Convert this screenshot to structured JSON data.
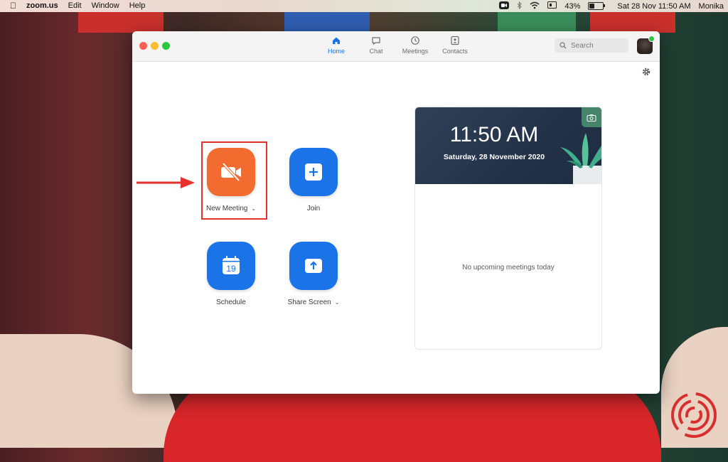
{
  "menubar": {
    "app": "zoom.us",
    "menus": [
      "Edit",
      "Window",
      "Help"
    ],
    "battery": "43%",
    "datetime": "Sat 28 Nov  11:50 AM",
    "user": "Monika"
  },
  "nav": {
    "tabs": [
      {
        "label": "Home",
        "icon": "home-icon",
        "active": true
      },
      {
        "label": "Chat",
        "icon": "chat-icon",
        "active": false
      },
      {
        "label": "Meetings",
        "icon": "clock-icon",
        "active": false
      },
      {
        "label": "Contacts",
        "icon": "contacts-icon",
        "active": false
      }
    ]
  },
  "search": {
    "placeholder": "Search"
  },
  "actions": {
    "new_meeting": "New Meeting",
    "join": "Join",
    "schedule": "Schedule",
    "schedule_day": "19",
    "share_screen": "Share Screen"
  },
  "card": {
    "time": "11:50 AM",
    "date": "Saturday, 28 November 2020",
    "empty_text": "No upcoming meetings today"
  },
  "colors": {
    "accent_blue": "#1a74e8",
    "new_meeting_orange": "#f26c2f",
    "highlight_red": "#e8312d"
  }
}
